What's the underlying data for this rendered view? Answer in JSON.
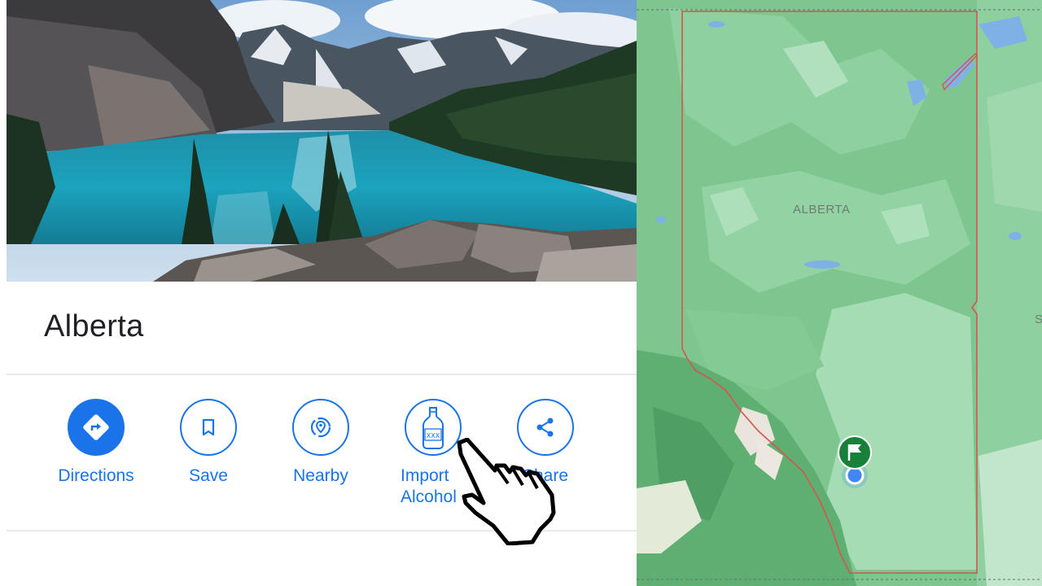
{
  "place": {
    "title": "Alberta"
  },
  "actions": [
    {
      "label": "Directions",
      "icon": "directions-icon"
    },
    {
      "label": "Save",
      "icon": "bookmark-icon"
    },
    {
      "label": "Nearby",
      "icon": "nearby-icon"
    },
    {
      "label": "Import\nAlcohol",
      "icon": "bottle-icon"
    },
    {
      "label": "Share",
      "icon": "share-icon"
    }
  ],
  "map": {
    "province_label": "ALBERTA",
    "edge_label": "S"
  },
  "colors": {
    "accent": "#1a73e8",
    "map_green": "#7ec68f",
    "border_red": "#d9534f",
    "pin_green": "#188038"
  }
}
